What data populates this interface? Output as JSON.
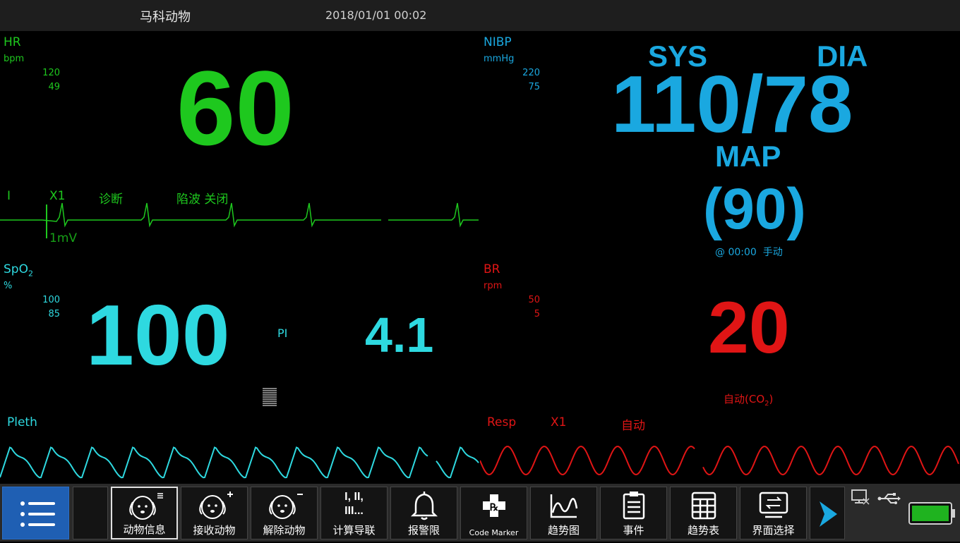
{
  "header": {
    "patient_name": "马科动物",
    "datetime": "2018/01/01 00:02"
  },
  "hr": {
    "label": "HR",
    "unit": "bpm",
    "limit_high": "120",
    "limit_low": "49",
    "value": "60",
    "ecg_lead": "I",
    "ecg_gain": "X1",
    "ecg_filter": "诊断",
    "notch": "陷波 关闭",
    "scale": "1mV"
  },
  "nibp": {
    "label": "NIBP",
    "unit": "mmHg",
    "limit_high": "220",
    "limit_low": "75",
    "sys_label": "SYS",
    "dia_label": "DIA",
    "value": "110/78",
    "map_label": "MAP",
    "map_value": "(90)",
    "time_info": "@ 00:00  手动"
  },
  "spo2": {
    "label_main": "SpO",
    "label_sub": "2",
    "unit": "%",
    "limit_high": "100",
    "limit_low": "85",
    "value": "100",
    "pi_label": "PI",
    "pi_value": "4.1",
    "pleth_label": "Pleth"
  },
  "br": {
    "label": "BR",
    "unit": "rpm",
    "limit_high": "50",
    "limit_low": "5",
    "value": "20",
    "source_main": "自动(CO",
    "source_sub": "2",
    "source_end": ")",
    "resp_label": "Resp",
    "resp_gain": "X1",
    "resp_mode": "自动"
  },
  "toolbar": {
    "buttons": [
      {
        "label": "动物信息"
      },
      {
        "label": "接收动物"
      },
      {
        "label": "解除动物"
      },
      {
        "label": "计算导联",
        "icon_text": "I, II,\nIII..."
      },
      {
        "label": "报警限"
      },
      {
        "label": "Code Marker"
      },
      {
        "label": "趋势图"
      },
      {
        "label": "事件"
      },
      {
        "label": "趋势表"
      },
      {
        "label": "界面选择"
      }
    ]
  },
  "colors": {
    "hr": "#1ec81e",
    "nibp": "#1aa8e0",
    "spo2": "#2ed9e0",
    "br": "#e01515",
    "menu": "#1f5fb3"
  }
}
